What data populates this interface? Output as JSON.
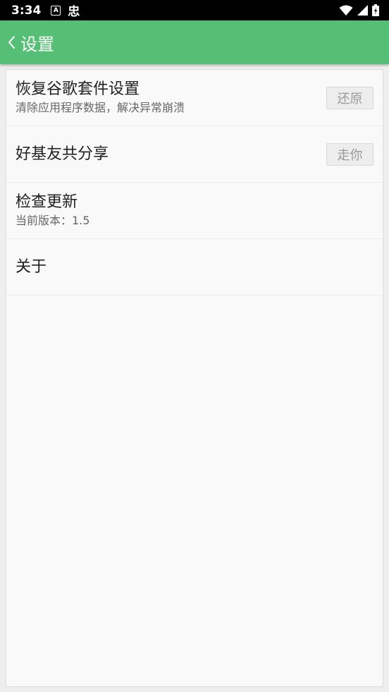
{
  "status_bar": {
    "time": "3:34",
    "notification_a": "A",
    "notification_b": "忠"
  },
  "appbar": {
    "title": "设置"
  },
  "settings": [
    {
      "title": "恢复谷歌套件设置",
      "subtitle": "清除应用程序数据，解决异常崩溃",
      "button": "还原"
    },
    {
      "title": "好基友共分享",
      "subtitle": "",
      "button": "走你"
    },
    {
      "title": "检查更新",
      "subtitle": "当前版本：1.5",
      "button": ""
    },
    {
      "title": "关于",
      "subtitle": "",
      "button": ""
    }
  ],
  "colors": {
    "appbar": "#56bf76",
    "status_bar": "#000000",
    "card": "#f9f9f9"
  },
  "icons": {
    "back": "chevron-left-icon",
    "wifi": "wifi-icon",
    "signal": "signal-icon",
    "battery": "battery-icon"
  }
}
